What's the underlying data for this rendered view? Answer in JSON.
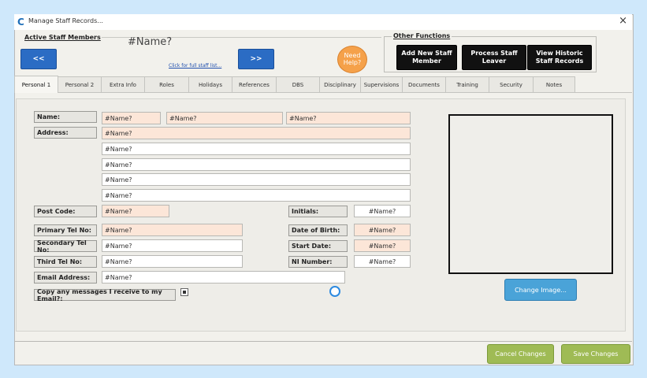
{
  "window": {
    "title": "Manage Staff Records...",
    "app_icon": "C",
    "close_glyph": "×"
  },
  "header": {
    "active_label": "Active Staff Members",
    "prev_label": "<<",
    "next_label": ">>",
    "staff_name": "#Name?",
    "full_list_link": "Click for full staff list...",
    "need_help": "Need Help?",
    "other_label": "Other Functions",
    "functions": [
      "Add New Staff Member",
      "Process Staff Leaver",
      "View Historic Staff Records"
    ]
  },
  "tabs": [
    "Personal 1",
    "Personal 2",
    "Extra Info",
    "Roles",
    "Holidays",
    "References",
    "DBS",
    "Disciplinary",
    "Supervisions",
    "Documents",
    "Training",
    "Security",
    "Notes"
  ],
  "form": {
    "name_label": "Name:",
    "name_values": [
      "#Name?",
      "#Name?",
      "#Name?"
    ],
    "address_label": "Address:",
    "address_lines": [
      "#Name?",
      "#Name?",
      "#Name?",
      "#Name?",
      "#Name?"
    ],
    "postcode_label": "Post Code:",
    "postcode_value": "#Name?",
    "initials_label": "Initials:",
    "initials_value": "#Name?",
    "primary_tel_label": "Primary Tel No:",
    "primary_tel_value": "#Name?",
    "dob_label": "Date of Birth:",
    "dob_value": "#Name?",
    "secondary_tel_label": "Secondary Tel No:",
    "secondary_tel_value": "#Name?",
    "start_date_label": "Start Date:",
    "start_date_value": "#Name?",
    "third_tel_label": "Third Tel No:",
    "third_tel_value": "#Name?",
    "ni_label": "NI Number:",
    "ni_value": "#Name?",
    "email_label": "Email Address:",
    "email_value": "#Name?",
    "copy_label": "Copy any messages I receive to my Email?:",
    "copy_checked": true
  },
  "photo": {
    "change_label": "Change Image..."
  },
  "footer": {
    "cancel_label": "Cancel Changes",
    "save_label": "Save Changes"
  },
  "colors": {
    "required_field": "#fce6d8",
    "nav_blue": "#2b6cc4",
    "help_orange": "#f5a14a",
    "footer_green": "#9fbb55",
    "image_button": "#4aa3d8"
  }
}
